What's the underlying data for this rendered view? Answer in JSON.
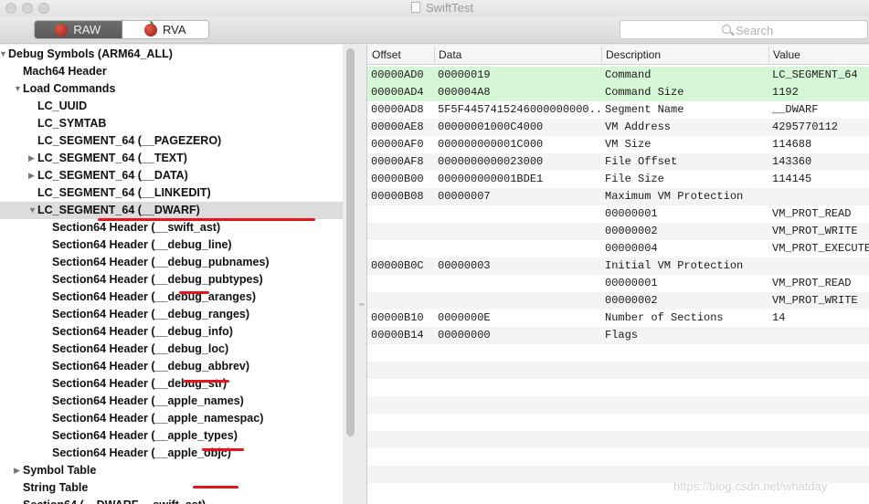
{
  "window": {
    "title": "SwiftTest"
  },
  "toolbar": {
    "raw_label": "RAW",
    "rva_label": "RVA",
    "search_placeholder": "Search"
  },
  "tree": [
    {
      "label": "Debug Symbols (ARM64_ALL)",
      "indent": 0,
      "toggle": "down"
    },
    {
      "label": "Mach64 Header",
      "indent": 1,
      "toggle": ""
    },
    {
      "label": "Load Commands",
      "indent": 1,
      "toggle": "down"
    },
    {
      "label": "LC_UUID",
      "indent": 2,
      "toggle": ""
    },
    {
      "label": "LC_SYMTAB",
      "indent": 2,
      "toggle": ""
    },
    {
      "label": "LC_SEGMENT_64 (__PAGEZERO)",
      "indent": 2,
      "toggle": ""
    },
    {
      "label": "LC_SEGMENT_64 (__TEXT)",
      "indent": 2,
      "toggle": "right"
    },
    {
      "label": "LC_SEGMENT_64 (__DATA)",
      "indent": 2,
      "toggle": "right"
    },
    {
      "label": "LC_SEGMENT_64 (__LINKEDIT)",
      "indent": 2,
      "toggle": ""
    },
    {
      "label": "LC_SEGMENT_64 (__DWARF)",
      "indent": 2,
      "toggle": "down",
      "selected": true
    },
    {
      "label": "Section64 Header (__swift_ast)",
      "indent": 3,
      "toggle": ""
    },
    {
      "label": "Section64 Header (__debug_line)",
      "indent": 3,
      "toggle": ""
    },
    {
      "label": "Section64 Header (__debug_pubnames)",
      "indent": 3,
      "toggle": ""
    },
    {
      "label": "Section64 Header (__debug_pubtypes)",
      "indent": 3,
      "toggle": ""
    },
    {
      "label": "Section64 Header (__debug_aranges)",
      "indent": 3,
      "toggle": ""
    },
    {
      "label": "Section64 Header (__debug_ranges)",
      "indent": 3,
      "toggle": ""
    },
    {
      "label": "Section64 Header (__debug_info)",
      "indent": 3,
      "toggle": ""
    },
    {
      "label": "Section64 Header (__debug_loc)",
      "indent": 3,
      "toggle": ""
    },
    {
      "label": "Section64 Header (__debug_abbrev)",
      "indent": 3,
      "toggle": ""
    },
    {
      "label": "Section64 Header (__debug_str)",
      "indent": 3,
      "toggle": ""
    },
    {
      "label": "Section64 Header (__apple_names)",
      "indent": 3,
      "toggle": ""
    },
    {
      "label": "Section64 Header (__apple_namespac)",
      "indent": 3,
      "toggle": ""
    },
    {
      "label": "Section64 Header (__apple_types)",
      "indent": 3,
      "toggle": ""
    },
    {
      "label": "Section64 Header (__apple_objc)",
      "indent": 3,
      "toggle": ""
    },
    {
      "label": "Symbol Table",
      "indent": 1,
      "toggle": "right"
    },
    {
      "label": "String Table",
      "indent": 1,
      "toggle": ""
    },
    {
      "label": "Section64 (__DWARF,__swift_ast)",
      "indent": 1,
      "toggle": ""
    }
  ],
  "table": {
    "columns": [
      "Offset",
      "Data",
      "Description",
      "Value"
    ],
    "rows": [
      {
        "offset": "00000AD0",
        "data": "00000019",
        "desc": "Command",
        "value": "LC_SEGMENT_64",
        "hl": true
      },
      {
        "offset": "00000AD4",
        "data": "000004A8",
        "desc": "Command Size",
        "value": "1192",
        "hl": true
      },
      {
        "offset": "00000AD8",
        "data": "5F5F4457415246000000000...",
        "desc": "Segment Name",
        "value": "__DWARF"
      },
      {
        "offset": "00000AE8",
        "data": "00000001000C4000",
        "desc": "VM Address",
        "value": "4295770112"
      },
      {
        "offset": "00000AF0",
        "data": "000000000001C000",
        "desc": "VM Size",
        "value": "114688"
      },
      {
        "offset": "00000AF8",
        "data": "0000000000023000",
        "desc": "File Offset",
        "value": "143360"
      },
      {
        "offset": "00000B00",
        "data": "000000000001BDE1",
        "desc": "File Size",
        "value": "114145"
      },
      {
        "offset": "00000B08",
        "data": "00000007",
        "desc": "Maximum VM Protection",
        "value": ""
      },
      {
        "offset": "",
        "data": "",
        "desc": "00000001",
        "value": "VM_PROT_READ"
      },
      {
        "offset": "",
        "data": "",
        "desc": "00000002",
        "value": "VM_PROT_WRITE"
      },
      {
        "offset": "",
        "data": "",
        "desc": "00000004",
        "value": "VM_PROT_EXECUTE"
      },
      {
        "offset": "00000B0C",
        "data": "00000003",
        "desc": "Initial VM Protection",
        "value": ""
      },
      {
        "offset": "",
        "data": "",
        "desc": "00000001",
        "value": "VM_PROT_READ"
      },
      {
        "offset": "",
        "data": "",
        "desc": "00000002",
        "value": "VM_PROT_WRITE"
      },
      {
        "offset": "00000B10",
        "data": "0000000E",
        "desc": "Number of Sections",
        "value": "14"
      },
      {
        "offset": "00000B14",
        "data": "00000000",
        "desc": "Flags",
        "value": ""
      }
    ]
  },
  "watermark": "https://blog.csdn.net/whatday"
}
